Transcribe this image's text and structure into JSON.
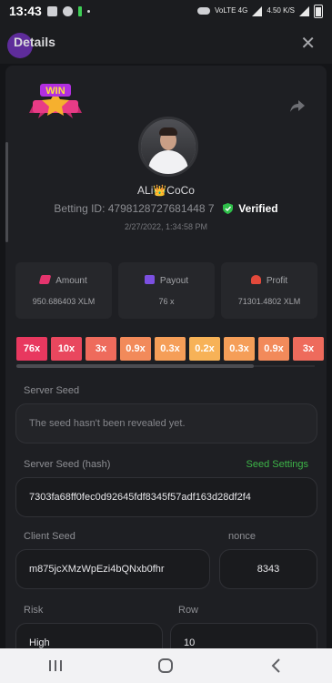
{
  "status_bar": {
    "time": "13:43",
    "network_label": "VoLTE 4G",
    "speed": "4.50 K/S"
  },
  "header": {
    "title": "Details"
  },
  "player": {
    "username": "ALi👑CoCo",
    "betting_id_label": "Betting ID: 4798128727681448 7",
    "verified_label": "Verified",
    "date": "2/27/2022, 1:34:58 PM"
  },
  "stats": {
    "amount": {
      "label": "Amount",
      "value": "950.686403 XLM"
    },
    "payout": {
      "label": "Payout",
      "value": "76 x"
    },
    "profit": {
      "label": "Profit",
      "value": "71301.4802 XLM"
    }
  },
  "multipliers": [
    {
      "label": "76x",
      "color": "#e8385f"
    },
    {
      "label": "10x",
      "color": "#e9475e"
    },
    {
      "label": "3x",
      "color": "#ee6b5c"
    },
    {
      "label": "0.9x",
      "color": "#f28a5a"
    },
    {
      "label": "0.3x",
      "color": "#f59e58"
    },
    {
      "label": "0.2x",
      "color": "#f7b257"
    },
    {
      "label": "0.3x",
      "color": "#f59e58"
    },
    {
      "label": "0.9x",
      "color": "#f28a5a"
    },
    {
      "label": "3x",
      "color": "#ee6b5c"
    }
  ],
  "fields": {
    "server_seed_label": "Server Seed",
    "server_seed_value": "The seed hasn't been revealed yet.",
    "server_seed_hash_label": "Server Seed (hash)",
    "seed_settings_label": "Seed Settings",
    "server_seed_hash_value": "7303fa68ff0fec0d92645fdf8345f57adf163d28df2f4",
    "client_seed_label": "Client Seed",
    "client_seed_value": "m875jcXMzWpEzi4bQNxb0fhr",
    "nonce_label": "nonce",
    "nonce_value": "8343",
    "risk_label": "Risk",
    "risk_value": "High",
    "row_label": "Row",
    "row_value": "10"
  },
  "colors": {
    "accent_green": "#3db548",
    "verified_green": "#2fbf4a",
    "amount_icon": "#e4346d",
    "payout_icon": "#7b4fe0",
    "profit_icon": "#e2493b"
  },
  "icons": {
    "close": "close-icon",
    "share": "share-icon",
    "win_badge": "win-badge-icon",
    "verified": "verified-shield-icon",
    "nav_recents": "recent-apps-icon",
    "nav_home": "home-icon",
    "nav_back": "back-icon"
  }
}
